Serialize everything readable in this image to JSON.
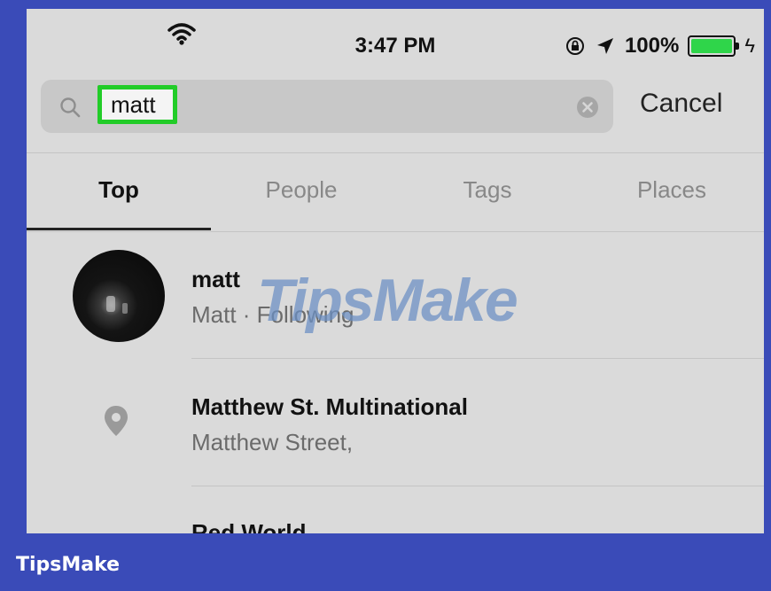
{
  "status_bar": {
    "time": "3:47 PM",
    "battery_percent": "100%",
    "battery_level": 1.0,
    "icons": [
      "wifi-icon",
      "rotation-lock-icon",
      "location-arrow-icon",
      "battery-icon",
      "charging-bolt-icon"
    ]
  },
  "search": {
    "value": "matt",
    "icon": "search-icon",
    "clear_icon": "clear-icon",
    "highlight_color": "#22cc28"
  },
  "cancel_label": "Cancel",
  "tabs": [
    {
      "label": "Top",
      "active": true
    },
    {
      "label": "People",
      "active": false
    },
    {
      "label": "Tags",
      "active": false
    },
    {
      "label": "Places",
      "active": false
    }
  ],
  "results": [
    {
      "type": "user",
      "title": "matt",
      "subtitle": "Matt · Following",
      "icon": "avatar"
    },
    {
      "type": "place",
      "title": "Matthew St. Multinational",
      "subtitle": "Matthew Street,",
      "icon": "location-pin-icon"
    },
    {
      "type": "partial",
      "title": "Red World"
    }
  ],
  "watermark": "TipsMake",
  "footer": {
    "brand": "TipsMake",
    "background": "#3a4bb8"
  }
}
